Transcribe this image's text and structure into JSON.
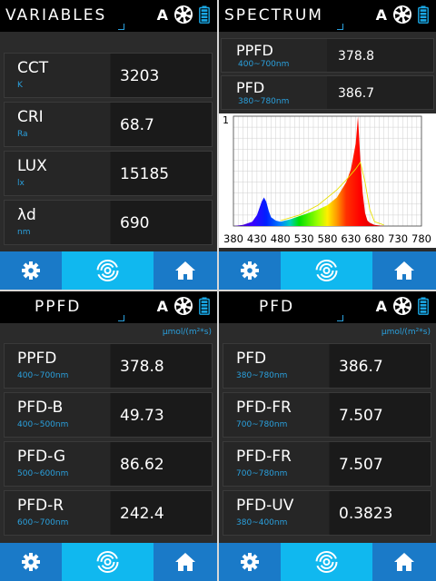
{
  "panels": {
    "variables": {
      "title": "VARIABLES",
      "rows": [
        {
          "name": "CCT",
          "sub": "K",
          "value": "3203"
        },
        {
          "name": "CRI",
          "sub": "Ra",
          "value": "68.7"
        },
        {
          "name": "LUX",
          "sub": "lx",
          "value": "15185"
        },
        {
          "name": "λd",
          "sub": "nm",
          "value": "690"
        }
      ]
    },
    "spectrum": {
      "title": "SPECTRUM",
      "rows": [
        {
          "name": "PPFD",
          "sub": "400~700nm",
          "value": "378.8"
        },
        {
          "name": "PFD",
          "sub": "380~780nm",
          "value": "386.7"
        }
      ]
    },
    "ppfd": {
      "title": "PPFD",
      "unit": "μmol/(m²*s)",
      "rows": [
        {
          "name": "PPFD",
          "sub": "400~700nm",
          "value": "378.8"
        },
        {
          "name": "PFD-B",
          "sub": "400~500nm",
          "value": "49.73"
        },
        {
          "name": "PFD-G",
          "sub": "500~600nm",
          "value": "86.62"
        },
        {
          "name": "PFD-R",
          "sub": "600~700nm",
          "value": "242.4"
        }
      ]
    },
    "pfd": {
      "title": "PFD",
      "unit": "μmol/(m²*s)",
      "rows": [
        {
          "name": "PFD",
          "sub": "380~780nm",
          "value": "386.7"
        },
        {
          "name": "PFD-FR",
          "sub": "700~780nm",
          "value": "7.507"
        },
        {
          "name": "PFD-FR",
          "sub": "700~780nm",
          "value": "7.507"
        },
        {
          "name": "PFD-UV",
          "sub": "380~400nm",
          "value": "0.3823"
        }
      ]
    }
  },
  "header_icons": {
    "auto_label": "A",
    "shutter": "shutter-icon",
    "battery": "battery-icon"
  },
  "nav_icons": [
    "gear-icon",
    "scan-icon",
    "home-icon"
  ],
  "colors": {
    "accent_blue": "#2aa0dd",
    "nav_blue": "#1a7ac8",
    "nav_active": "#10b8ef"
  },
  "chart_data": {
    "type": "area",
    "y_tick_labels": [
      "1"
    ],
    "x_tick_labels": [
      "380",
      "430",
      "480",
      "530",
      "580",
      "630",
      "680",
      "730",
      "780"
    ],
    "xlim": [
      380,
      780
    ],
    "ylim": [
      0,
      1
    ],
    "grid": true,
    "x": [
      380,
      400,
      420,
      430,
      440,
      445,
      450,
      455,
      460,
      470,
      480,
      500,
      520,
      540,
      560,
      580,
      600,
      620,
      630,
      640,
      645,
      650,
      655,
      660,
      665,
      670,
      680,
      700,
      730,
      780
    ],
    "values": [
      0.0,
      0.01,
      0.04,
      0.1,
      0.22,
      0.26,
      0.22,
      0.14,
      0.08,
      0.05,
      0.04,
      0.06,
      0.09,
      0.12,
      0.15,
      0.19,
      0.26,
      0.4,
      0.52,
      0.75,
      1.0,
      0.6,
      0.3,
      0.12,
      0.05,
      0.03,
      0.01,
      0.0,
      0.0,
      0.0
    ],
    "overlay_x": [
      480,
      520,
      560,
      600,
      620,
      640,
      650,
      660,
      670,
      680,
      700
    ],
    "overlay_values": [
      0.05,
      0.1,
      0.19,
      0.33,
      0.42,
      0.52,
      0.58,
      0.4,
      0.15,
      0.04,
      0.01
    ]
  }
}
